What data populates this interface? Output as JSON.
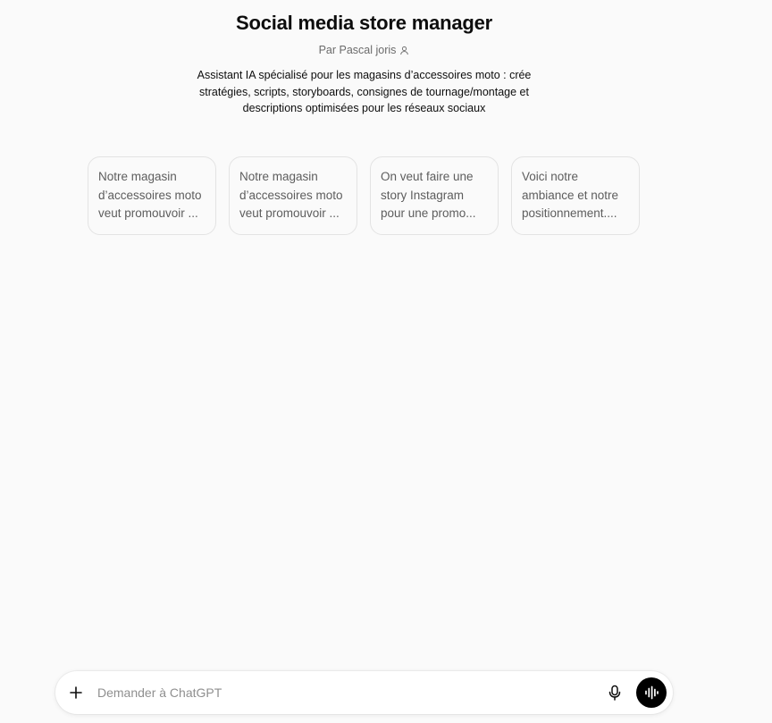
{
  "gpt": {
    "title": "Social media store manager",
    "author": "Par Pascal joris",
    "description": "Assistant IA spécialisé pour les magasins d’accessoires moto : crée stratégies, scripts, storyboards, consignes de tournage/montage et descriptions optimisées pour les réseaux sociaux"
  },
  "conversation_starters": [
    {
      "text": "Notre magasin d’accessoires moto veut promouvoir ..."
    },
    {
      "text": "Notre magasin d’accessoires moto veut promouvoir ..."
    },
    {
      "text": "On veut faire une story Instagram pour une promo..."
    },
    {
      "text": "Voici notre ambiance et notre positionnement...."
    }
  ],
  "composer": {
    "placeholder": "Demander à ChatGPT",
    "icons": {
      "add": "plus-icon",
      "dictate": "microphone-icon",
      "voice": "voice-waveform-icon"
    }
  },
  "colors": {
    "background": "#fafafa",
    "voice_button": "#000000",
    "muted_text": "#6b6b6b"
  }
}
